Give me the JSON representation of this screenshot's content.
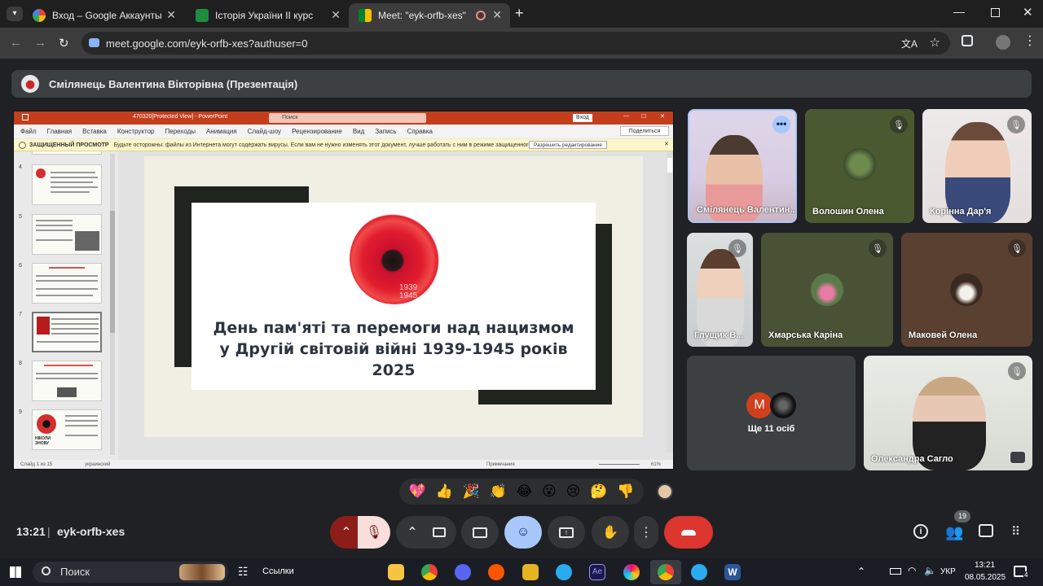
{
  "browser": {
    "tabs": [
      {
        "title": "Вход – Google Аккаунты",
        "favicon": "google-g-icon",
        "color": "#4285f4"
      },
      {
        "title": "Історія України ІІ курс",
        "favicon": "classroom-icon",
        "color": "#1e8e3e"
      },
      {
        "title": "Meet: \"eyk-orfb-xes\"",
        "favicon": "meet-icon",
        "color": "#00897b",
        "active": true
      }
    ],
    "url": "meet.google.com/eyk-orfb-xes?authuser=0"
  },
  "meet": {
    "presenter": "Смілянець Валентина Вікторівна (Презентація)",
    "time": "13:21",
    "meeting_code": "eyk-orfb-xes",
    "participants_count": "19",
    "tiles": [
      {
        "name": "Смілянець Валентин..."
      },
      {
        "name": "Волошин Олена"
      },
      {
        "name": "Корінна Дар'я"
      },
      {
        "name": "Глущик В..."
      },
      {
        "name": "Хмарська Каріна"
      },
      {
        "name": "Маковей Олена"
      },
      {
        "name": "Ще 11 осіб",
        "initial": "M"
      },
      {
        "name": "Олександра Сагло"
      }
    ],
    "reactions": [
      "💖",
      "👍",
      "🎉",
      "👏",
      "😂",
      "😮",
      "😢",
      "🤔",
      "👎"
    ],
    "accent_red": "#ea4335",
    "accent_blue": "#a8c7fa"
  },
  "powerpoint": {
    "window_title": "470320[Protected View] - PowerPoint",
    "search": "Поиск",
    "signin": "Вход",
    "menu": [
      "Файл",
      "Главная",
      "Вставка",
      "Конструктор",
      "Переходы",
      "Анимация",
      "Слайд-шоу",
      "Рецензирование",
      "Вид",
      "Запись",
      "Справка"
    ],
    "share": "Поделиться",
    "warn_label": "ЗАЩИЩЕННЫЙ ПРОСМОТР",
    "warn_text": "Будьте осторожны: файлы из Интернета могут содержать вирусы. Если вам не нужно изменять этот документ, лучше работать с ним в режиме защищенного просмотра.",
    "enable_edit": "Разрешить редактирование",
    "thumb_numbers": [
      "4",
      "5",
      "6",
      "7",
      "8",
      "9"
    ],
    "slide_title_lines": [
      "День пам'яті та перемоги над нацизмом",
      "у Другій світовій війні 1939-1945 років",
      "2025"
    ],
    "slide_years": [
      "1939",
      "1945"
    ],
    "thumb9_text": "НІКОЛИ ЗНОВУ",
    "status_slide": "Слайд 1 из 15",
    "status_lang": "украинский",
    "status_notes": "Примечания",
    "zoom": "61%"
  },
  "taskbar": {
    "search": "Поиск",
    "links": "Ссылки",
    "lang": "УКР",
    "time": "13:21",
    "date": "08.05.2025",
    "notif_count": "4"
  }
}
